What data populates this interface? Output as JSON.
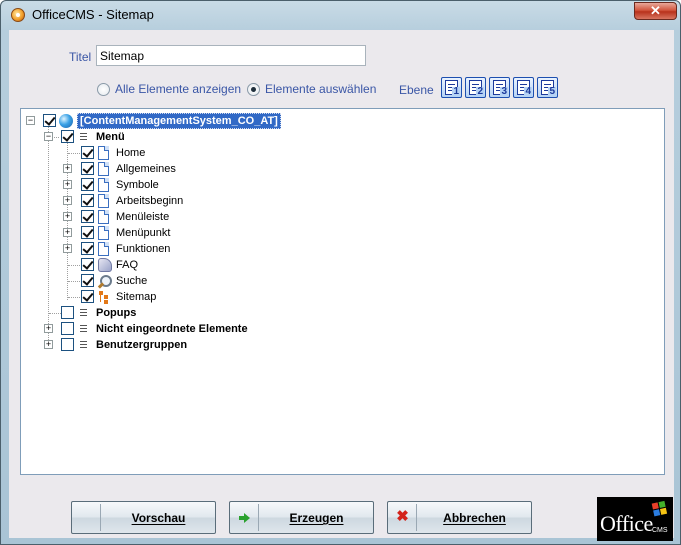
{
  "window": {
    "title": "OfficeCMS - Sitemap",
    "close_glyph": "✕"
  },
  "form": {
    "title_label": "Titel",
    "title_value": "Sitemap",
    "radio_all_label": "Alle Elemente anzeigen",
    "radio_all_selected": false,
    "radio_select_label": "Elemente auswählen",
    "radio_select_selected": true,
    "level_label": "Ebene",
    "levels": [
      "1",
      "2",
      "3",
      "4",
      "5"
    ]
  },
  "tree": {
    "root": {
      "label": "[ContentManagementSystem_CO_AT]",
      "checked": true,
      "icon": "globe-icon",
      "selected": true
    },
    "nodes": [
      {
        "label": "Menü",
        "checked": true,
        "bold": true,
        "icon": "list-icon",
        "expanded": true
      },
      {
        "label": "Home",
        "checked": true,
        "icon": "page-icon"
      },
      {
        "label": "Allgemeines",
        "checked": true,
        "icon": "page-icon",
        "collapsed": true
      },
      {
        "label": "Symbole",
        "checked": true,
        "icon": "page-icon",
        "collapsed": true
      },
      {
        "label": "Arbeitsbeginn",
        "checked": true,
        "icon": "page-icon",
        "collapsed": true
      },
      {
        "label": "Menüleiste",
        "checked": true,
        "icon": "page-icon",
        "collapsed": true
      },
      {
        "label": "Menüpunkt",
        "checked": true,
        "icon": "page-icon",
        "collapsed": true
      },
      {
        "label": "Funktionen",
        "checked": true,
        "icon": "page-icon",
        "collapsed": true
      },
      {
        "label": "FAQ",
        "checked": true,
        "icon": "faq-icon"
      },
      {
        "label": "Suche",
        "checked": true,
        "icon": "search-icon"
      },
      {
        "label": "Sitemap",
        "checked": true,
        "icon": "sitemap-icon"
      },
      {
        "label": "Popups",
        "checked": false,
        "bold": true,
        "icon": "list-icon"
      },
      {
        "label": "Nicht eingeordnete Elemente",
        "checked": false,
        "bold": true,
        "icon": "list-icon",
        "collapsed": true
      },
      {
        "label": "Benutzergruppen",
        "checked": false,
        "bold": true,
        "icon": "list-icon",
        "collapsed": true
      }
    ]
  },
  "buttons": {
    "preview_label": "Vorschau",
    "generate_label": "Erzeugen",
    "cancel_label": "Abbrechen"
  },
  "logo": {
    "word": "Office",
    "sub": "CMS",
    "flag_colors": [
      "#e8402a",
      "#43b02a",
      "#2b7de0",
      "#f5c414"
    ]
  }
}
